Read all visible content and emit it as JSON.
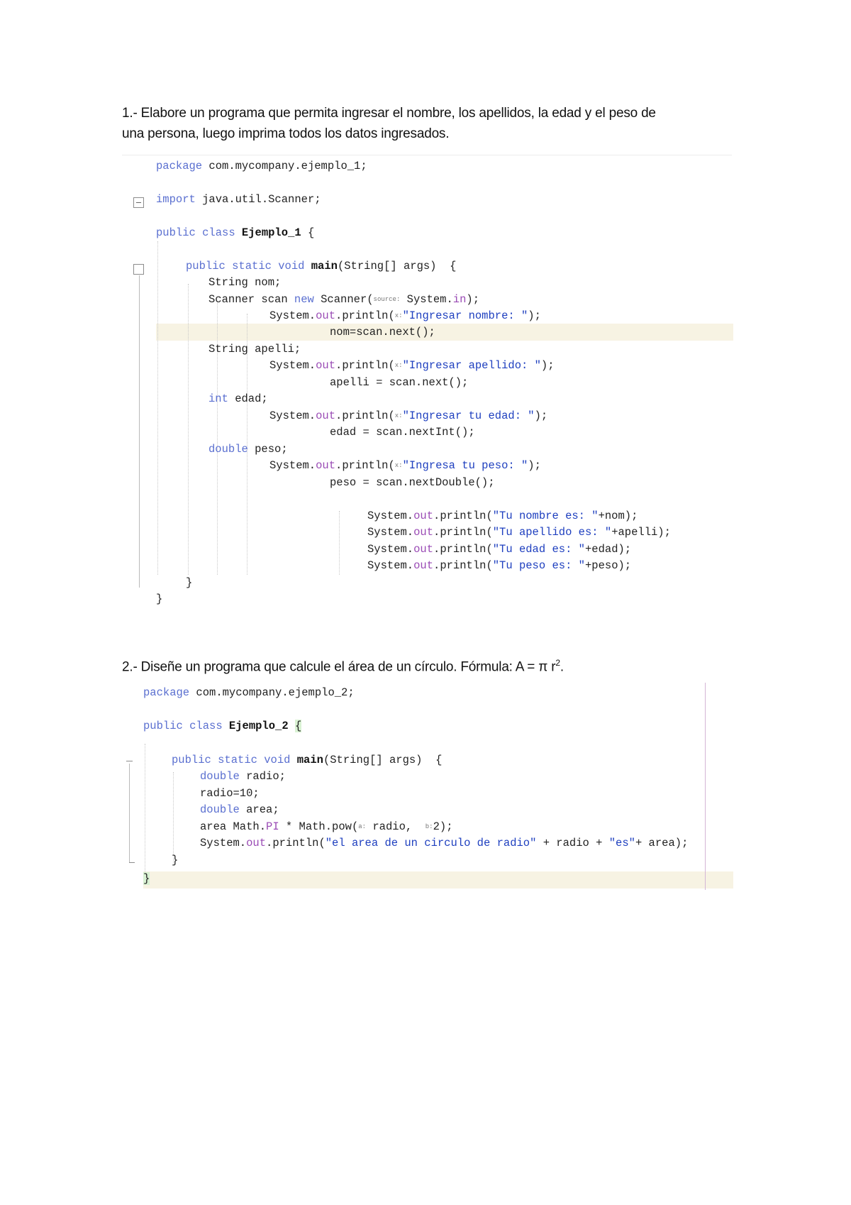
{
  "q1": {
    "line1": "1.- Elabore un programa que permita ingresar el nombre, los apellidos, la edad y el peso de",
    "line2": "una persona, luego imprima todos los datos ingresados."
  },
  "code1": {
    "l_package_kw": "package",
    "l_package_rest": " com.mycompany.ejemplo_1;",
    "l_import_kw": "import",
    "l_import_rest": " java.util.Scanner;",
    "l_class_kw": "public class",
    "l_class_name": " Ejemplo_1",
    "l_class_brace": " {",
    "l_main_kw": "public static void",
    "l_main_name": " main",
    "l_main_rest": "(String[] args)  {",
    "l_string_nom": "String nom;",
    "l_scanner_a": "Scanner scan ",
    "l_scanner_new": "new",
    "l_scanner_b": " Scanner(",
    "l_scanner_hint": "source:",
    "l_scanner_c": " System.",
    "l_scanner_in": "in",
    "l_scanner_d": ");",
    "l_p1_a": "System.",
    "l_p1_out": "out",
    "l_p1_b": ".println(",
    "l_p1_hint": "x:",
    "l_p1_str": "\"Ingresar nombre: \"",
    "l_p1_c": ");",
    "l_nom_next": "nom=scan.next();",
    "l_string_apelli": "String apelli;",
    "l_p2_a": "System.",
    "l_p2_out": "out",
    "l_p2_b": ".println(",
    "l_p2_hint": "x:",
    "l_p2_str": "\"Ingresar apellido: \"",
    "l_p2_c": ");",
    "l_apelli_next": "apelli = scan.next();",
    "l_int_kw": "int",
    "l_int_rest": " edad;",
    "l_p3_a": "System.",
    "l_p3_out": "out",
    "l_p3_b": ".println(",
    "l_p3_hint": "x:",
    "l_p3_str": "\"Ingresar tu edad: \"",
    "l_p3_c": ");",
    "l_edad_next": "edad = scan.nextInt();",
    "l_double_kw": "double",
    "l_double_rest": " peso;",
    "l_p4_a": "System.",
    "l_p4_out": "out",
    "l_p4_b": ".println(",
    "l_p4_hint": "x:",
    "l_p4_str": "\"Ingresa tu peso: \"",
    "l_p4_c": ");",
    "l_peso_next": "peso = scan.nextDouble();",
    "l_o1_a": "System.",
    "l_o1_out": "out",
    "l_o1_b": ".println(",
    "l_o1_str": "\"Tu nombre es: \"",
    "l_o1_c": "+nom);",
    "l_o2_a": "System.",
    "l_o2_out": "out",
    "l_o2_b": ".println(",
    "l_o2_str": "\"Tu apellido es: \"",
    "l_o2_c": "+apelli);",
    "l_o3_a": "System.",
    "l_o3_out": "out",
    "l_o3_b": ".println(",
    "l_o3_str": "\"Tu edad es: \"",
    "l_o3_c": "+edad);",
    "l_o4_a": "System.",
    "l_o4_out": "out",
    "l_o4_b": ".println(",
    "l_o4_str": "\"Tu peso es: \"",
    "l_o4_c": "+peso);",
    "l_close_method": "}",
    "l_close_class": "}"
  },
  "q2": {
    "text": "2.- Diseñe un programa que calcule el área de un círculo. Fórmula: A = π r",
    "sup": "2",
    "end": "."
  },
  "code2": {
    "l_package_kw": "package",
    "l_package_rest": " com.mycompany.ejemplo_2;",
    "l_class_kw": "public class",
    "l_class_name": " Ejemplo_2",
    "l_class_brace": "{",
    "l_main_kw": "public static void",
    "l_main_name": " main",
    "l_main_rest": "(String[] args)  {",
    "l_double_kw": "double",
    "l_double_rest": " radio;",
    "l_radio_assign": "radio=10;",
    "l_double2_kw": "double",
    "l_double2_rest": " area;",
    "l_area_a": "area Math.",
    "l_area_pi": "PI",
    "l_area_b": " * Math.pow(",
    "l_area_hint1": "a:",
    "l_area_c": " radio,  ",
    "l_area_hint2": "b:",
    "l_area_d": "2);",
    "l_print_a": "System.",
    "l_print_out": "out",
    "l_print_b": ".println(",
    "l_print_str1": "\"el area de un circulo de radio\"",
    "l_print_c": " + radio + ",
    "l_print_str2": "\"es\"",
    "l_print_d": "+ area);",
    "l_close_method": "}",
    "l_close_class": "}"
  }
}
